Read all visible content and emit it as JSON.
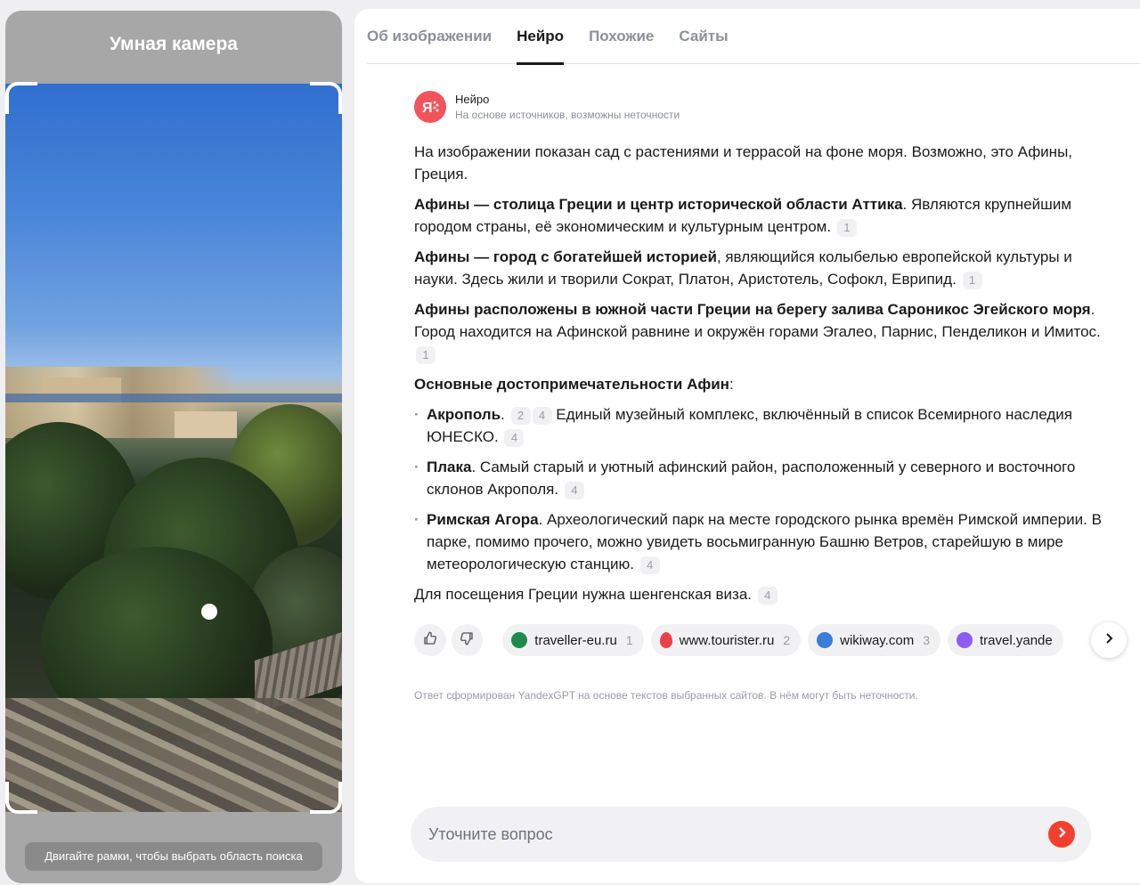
{
  "camera": {
    "title": "Умная камера",
    "hint": "Двигайте рамки, чтобы выбрать область поиска"
  },
  "tabs": [
    {
      "label": "Об изображении",
      "active": false
    },
    {
      "label": "Нейро",
      "active": true
    },
    {
      "label": "Похожие",
      "active": false
    },
    {
      "label": "Сайты",
      "active": false
    }
  ],
  "neuro": {
    "name": "Нейро",
    "subtitle": "На основе источников, возможны неточности",
    "logo_icon": "yandex-neuro-logo-icon"
  },
  "answer": {
    "intro": "На изображении показан сад с растениями и террасой на фоне моря. Возможно, это Афины, Греция.",
    "p1_bold": "Афины — столица Греции и центр исторической области Аттика",
    "p1_rest": ". Являются крупнейшим городом страны, её экономическим и культурным центром.",
    "p1_ref": "1",
    "p2_bold": "Афины — город с богатейшей историей",
    "p2_rest": ", являющийся колыбелью европейской культуры и науки. Здесь жили и творили Сократ, Платон, Аристотель, Софокл, Еврипид.",
    "p2_ref": "1",
    "p3_bold": "Афины расположены в южной части Греции на берегу залива Сароникос Эгейского моря",
    "p3_rest": ". Город находится на Афинской равнине и окружён горами Эгалео, Парнис, Пенделикон и Имитос.",
    "p3_ref": "1",
    "sights_heading": "Основные достопримечательности Афин",
    "sights_colon": ":",
    "sights": [
      {
        "name": "Акрополь",
        "refs_inline": [
          "2",
          "4"
        ],
        "text": "Единый музейный комплекс, включённый в список Всемирного наследия ЮНЕСКО.",
        "ref": "4"
      },
      {
        "name": "Плака",
        "text": ". Самый старый и уютный афинский район, расположенный у северного и восточного склонов Акрополя.",
        "ref": "4"
      },
      {
        "name": "Римская Агора",
        "text": ". Археологический парк на месте городского рынка времён Римской империи. В парке, помимо прочего, можно увидеть восьмигранную Башню Ветров, старейшую в мире метеорологическую станцию.",
        "ref": "4"
      }
    ],
    "visa": "Для посещения Греции нужна шенгенская виза.",
    "visa_ref": "4"
  },
  "feedback": {
    "like_icon": "thumbs-up-icon",
    "dislike_icon": "thumbs-down-icon"
  },
  "sources": [
    {
      "label": "traveller-eu.ru",
      "num": "1",
      "icon": "traveller-globe-icon",
      "color": "#1f8a4c"
    },
    {
      "label": "www.tourister.ru",
      "num": "2",
      "icon": "tourister-balloon-icon",
      "color": "#e8414a"
    },
    {
      "label": "wikiway.com",
      "num": "3",
      "icon": "wikiway-globe-icon",
      "color": "#3b7dd8"
    },
    {
      "label": "travel.yande",
      "num": "",
      "icon": "yandex-travel-icon",
      "color": "#8e5cf0"
    }
  ],
  "disclaimer": "Ответ сформирован YandexGPT на основе текстов выбранных сайтов. В нём могут быть неточности.",
  "ask": {
    "placeholder": "Уточните вопрос",
    "send_icon": "send-arrow-icon"
  },
  "colors": {
    "accent_red": "#f2402e",
    "neuro_logo": "#f2545b",
    "muted_text": "#8d8f99"
  }
}
